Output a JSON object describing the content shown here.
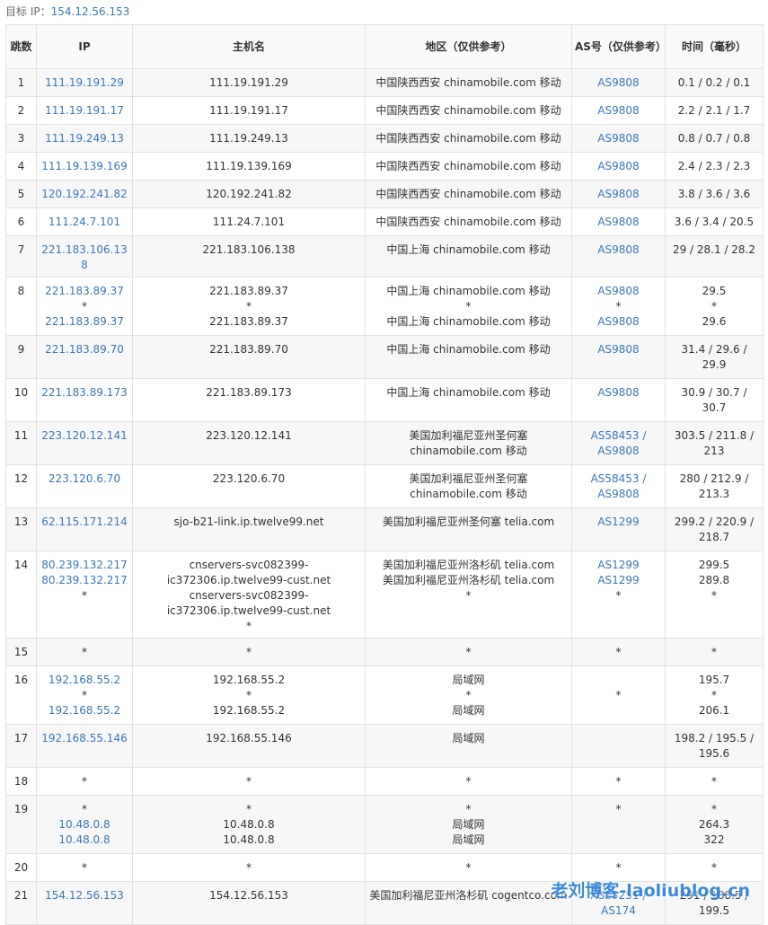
{
  "target": {
    "label": "目标 IP：",
    "ip": "154.12.56.153"
  },
  "columns": [
    "跳数",
    "IP",
    "主机名",
    "地区（仅供参考）",
    "AS号（仅供参考）",
    "时间（毫秒）"
  ],
  "rows": [
    {
      "hop": "1",
      "ip": [
        "111.19.191.29"
      ],
      "host": [
        "111.19.191.29"
      ],
      "region": [
        "中国陕西西安 chinamobile.com 移动"
      ],
      "as": [
        "AS9808"
      ],
      "time": [
        "0.1 / 0.2 / 0.1"
      ]
    },
    {
      "hop": "2",
      "ip": [
        "111.19.191.17"
      ],
      "host": [
        "111.19.191.17"
      ],
      "region": [
        "中国陕西西安 chinamobile.com 移动"
      ],
      "as": [
        "AS9808"
      ],
      "time": [
        "2.2 / 2.1 / 1.7"
      ]
    },
    {
      "hop": "3",
      "ip": [
        "111.19.249.13"
      ],
      "host": [
        "111.19.249.13"
      ],
      "region": [
        "中国陕西西安 chinamobile.com 移动"
      ],
      "as": [
        "AS9808"
      ],
      "time": [
        "0.8 / 0.7 / 0.8"
      ]
    },
    {
      "hop": "4",
      "ip": [
        "111.19.139.169"
      ],
      "host": [
        "111.19.139.169"
      ],
      "region": [
        "中国陕西西安 chinamobile.com 移动"
      ],
      "as": [
        "AS9808"
      ],
      "time": [
        "2.4 / 2.3 / 2.3"
      ]
    },
    {
      "hop": "5",
      "ip": [
        "120.192.241.82"
      ],
      "host": [
        "120.192.241.82"
      ],
      "region": [
        "中国陕西西安 chinamobile.com 移动"
      ],
      "as": [
        "AS9808"
      ],
      "time": [
        "3.8 / 3.6 / 3.6"
      ]
    },
    {
      "hop": "6",
      "ip": [
        "111.24.7.101"
      ],
      "host": [
        "111.24.7.101"
      ],
      "region": [
        "中国陕西西安 chinamobile.com 移动"
      ],
      "as": [
        "AS9808"
      ],
      "time": [
        "3.6 / 3.4 / 20.5"
      ]
    },
    {
      "hop": "7",
      "ip": [
        "221.183.106.138"
      ],
      "host": [
        "221.183.106.138"
      ],
      "region": [
        "中国上海 chinamobile.com 移动"
      ],
      "as": [
        "AS9808"
      ],
      "time": [
        "29 / 28.1 / 28.2"
      ]
    },
    {
      "hop": "8",
      "ip": [
        "221.183.89.37",
        "*",
        "221.183.89.37"
      ],
      "host": [
        "221.183.89.37",
        "*",
        "221.183.89.37"
      ],
      "region": [
        "中国上海 chinamobile.com 移动",
        "*",
        "中国上海 chinamobile.com 移动"
      ],
      "as": [
        "AS9808",
        "*",
        "AS9808"
      ],
      "time": [
        "29.5",
        "*",
        "29.6"
      ]
    },
    {
      "hop": "9",
      "ip": [
        "221.183.89.70"
      ],
      "host": [
        "221.183.89.70"
      ],
      "region": [
        "中国上海 chinamobile.com 移动"
      ],
      "as": [
        "AS9808"
      ],
      "time": [
        "31.4 / 29.6 /",
        "29.9"
      ]
    },
    {
      "hop": "10",
      "ip": [
        "221.183.89.173"
      ],
      "host": [
        "221.183.89.173"
      ],
      "region": [
        "中国上海 chinamobile.com 移动"
      ],
      "as": [
        "AS9808"
      ],
      "time": [
        "30.9 / 30.7 /",
        "30.7"
      ]
    },
    {
      "hop": "11",
      "ip": [
        "223.120.12.141"
      ],
      "host": [
        "223.120.12.141"
      ],
      "region": [
        "美国加利福尼亚州圣何塞",
        "chinamobile.com 移动"
      ],
      "as": [
        "AS58453 /",
        "AS9808"
      ],
      "time": [
        "303.5 / 211.8 /",
        "213"
      ]
    },
    {
      "hop": "12",
      "ip": [
        "223.120.6.70"
      ],
      "host": [
        "223.120.6.70"
      ],
      "region": [
        "美国加利福尼亚州圣何塞",
        "chinamobile.com 移动"
      ],
      "as": [
        "AS58453 /",
        "AS9808"
      ],
      "time": [
        "280 / 212.9 /",
        "213.3"
      ]
    },
    {
      "hop": "13",
      "ip": [
        "62.115.171.214"
      ],
      "host": [
        "sjo-b21-link.ip.twelve99.net"
      ],
      "region": [
        "美国加利福尼亚州圣何塞 telia.com"
      ],
      "as": [
        "AS1299"
      ],
      "time": [
        "299.2 / 220.9 /",
        "218.7"
      ]
    },
    {
      "hop": "14",
      "ip": [
        "80.239.132.217",
        "80.239.132.217",
        "*"
      ],
      "host": [
        "cnservers-svc082399-ic372306.ip.twelve99-cust.net",
        "cnservers-svc082399-ic372306.ip.twelve99-cust.net",
        "*"
      ],
      "region": [
        "美国加利福尼亚州洛杉矶 telia.com",
        "美国加利福尼亚州洛杉矶 telia.com",
        "*"
      ],
      "as": [
        "AS1299",
        "AS1299",
        "*"
      ],
      "time": [
        "299.5",
        "289.8",
        "*"
      ]
    },
    {
      "hop": "15",
      "ip": [
        "*"
      ],
      "host": [
        "*"
      ],
      "region": [
        "*"
      ],
      "as": [
        "*"
      ],
      "time": [
        "*"
      ]
    },
    {
      "hop": "16",
      "ip": [
        "192.168.55.2",
        "*",
        "192.168.55.2"
      ],
      "host": [
        "192.168.55.2",
        "*",
        "192.168.55.2"
      ],
      "region": [
        "局域网",
        "*",
        "局域网"
      ],
      "as": [
        "",
        "*",
        ""
      ],
      "time": [
        "195.7",
        "*",
        "206.1"
      ]
    },
    {
      "hop": "17",
      "ip": [
        "192.168.55.146"
      ],
      "host": [
        "192.168.55.146"
      ],
      "region": [
        "局域网"
      ],
      "as": [
        ""
      ],
      "time": [
        "198.2 / 195.5 /",
        "195.6"
      ]
    },
    {
      "hop": "18",
      "ip": [
        "*"
      ],
      "host": [
        "*"
      ],
      "region": [
        "*"
      ],
      "as": [
        "*"
      ],
      "time": [
        "*"
      ]
    },
    {
      "hop": "19",
      "ip": [
        "*",
        "10.48.0.8",
        "10.48.0.8"
      ],
      "host": [
        "*",
        "10.48.0.8",
        "10.48.0.8"
      ],
      "region": [
        "*",
        "局域网",
        "局域网"
      ],
      "as": [
        "*"
      ],
      "time": [
        "*",
        "264.3",
        "322"
      ]
    },
    {
      "hop": "20",
      "ip": [
        "*"
      ],
      "host": [
        "*"
      ],
      "region": [
        "*"
      ],
      "as": [
        "*"
      ],
      "time": [
        "*"
      ]
    },
    {
      "hop": "21",
      "ip": [
        "154.12.56.153"
      ],
      "host": [
        "154.12.56.153"
      ],
      "region": [
        "美国加利福尼亚州洛杉矶 cogentco.com"
      ],
      "as": [
        "AS25251 /",
        "AS174"
      ],
      "time": [
        "291 / 188.5 /",
        "199.5"
      ]
    }
  ],
  "watermark": "老刘博客-laoliublog.cn",
  "colors": {
    "link": "#3a78b5",
    "border": "#e2e2e2",
    "zebra": "#f7f7f7",
    "watermark": "#2a7fd4"
  }
}
